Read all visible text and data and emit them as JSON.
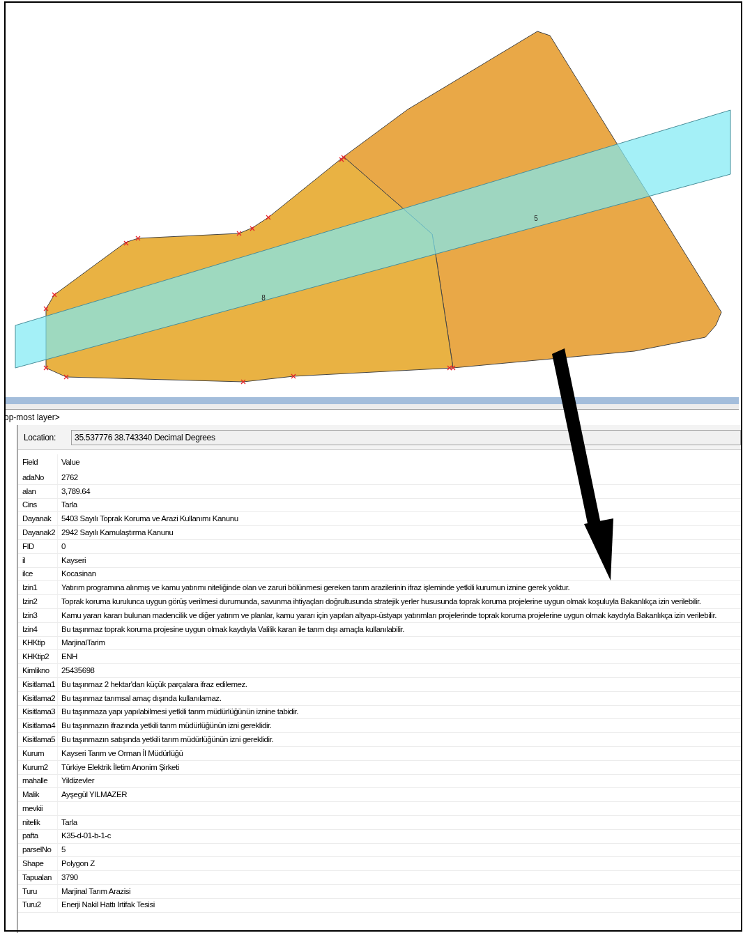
{
  "map": {
    "labels": [
      "8",
      "5"
    ]
  },
  "layer_dropdown": {
    "value": "op-most layer>"
  },
  "location": {
    "label": "Location:",
    "value": "35.537776  38.743340 Decimal Degrees"
  },
  "table": {
    "columns": [
      "Field",
      "Value"
    ],
    "rows": [
      {
        "field": "adaNo",
        "value": "2762"
      },
      {
        "field": "alan",
        "value": "3,789.64"
      },
      {
        "field": "Cins",
        "value": "Tarla"
      },
      {
        "field": "Dayanak",
        "value": "5403 Sayılı Toprak Koruma ve Arazi Kullanımı Kanunu"
      },
      {
        "field": "Dayanak2",
        "value": "2942 Sayılı Kamulaştırma Kanunu"
      },
      {
        "field": "FID",
        "value": "0"
      },
      {
        "field": "il",
        "value": "Kayseri"
      },
      {
        "field": "ilce",
        "value": "Kocasinan"
      },
      {
        "field": "Izin1",
        "value": "Yatırım programına alınmış ve kamu yatırımı niteliğinde olan ve zaruri bölünmesi gereken tarım arazilerinin ifraz işleminde yetkili kurumun iznine gerek yoktur."
      },
      {
        "field": "Izin2",
        "value": "Toprak koruma kurulunca uygun görüş  verilmesi durumunda, savunma ihtiyaçları doğrultusunda stratejik yerler hususunda toprak koruma projelerine uygun olmak koşuluyla Bakanlıkça izin verilebilir."
      },
      {
        "field": "Izin3",
        "value": "Kamu yararı kararı bulunan madencilik ve diğer yatırım ve planlar, kamu yararı için yapılan altyapı-üstyapı yatırımları  projelerinde toprak koruma projelerine uygun olmak kaydıyla Bakanlıkça izin verilebilir."
      },
      {
        "field": "Izin4",
        "value": "Bu taşınmaz toprak koruma projesine uygun olmak kaydıyla Valilik kararı ile tarım dışı amaçla kullanılabilir."
      },
      {
        "field": "KHKtip",
        "value": "MarjinalTarim"
      },
      {
        "field": "KHKtip2",
        "value": "ENH"
      },
      {
        "field": "Kimlikno",
        "value": "25435698"
      },
      {
        "field": "Kisitlama1",
        "value": "Bu taşınmaz 2 hektar'dan küçük parçalara ifraz edilemez."
      },
      {
        "field": "Kisitlama2",
        "value": "Bu taşınmaz tarımsal amaç  dışında kullanılamaz."
      },
      {
        "field": "Kisitlama3",
        "value": "Bu taşınmaza yapı yapılabilmesi yetkili tarım müdürlüğünün iznine tabidir."
      },
      {
        "field": "Kisitlama4",
        "value": "Bu taşınmazın ifrazında yetkili tarım müdürlüğünün izni gereklidir."
      },
      {
        "field": "Kisitlama5",
        "value": "Bu taşınmazın satışında yetkili tarım müdürlüğünün izni gereklidir."
      },
      {
        "field": "Kurum",
        "value": "Kayseri Tarım ve Orman İl Müdürlüğü"
      },
      {
        "field": "Kurum2",
        "value": "Türkiye Elektrik İletim Anonim Şirketi"
      },
      {
        "field": "mahalle",
        "value": "Yildizevler"
      },
      {
        "field": "Malik",
        "value": "Ayşegül YILMAZER"
      },
      {
        "field": "mevkii"
      },
      {
        "field": "nitelik",
        "value": "Tarla"
      },
      {
        "field": "pafta",
        "value": "K35-d-01-b-1-c"
      },
      {
        "field": "parselNo",
        "value": "5"
      },
      {
        "field": "Shape",
        "value": "Polygon Z"
      },
      {
        "field": "Tapualan",
        "value": "3790"
      },
      {
        "field": "Turu",
        "value": "Marjinal Tarım Arazisi"
      },
      {
        "field": "Turu2",
        "value": "Enerji Nakil Hattı Irtifak Tesisi"
      }
    ]
  }
}
